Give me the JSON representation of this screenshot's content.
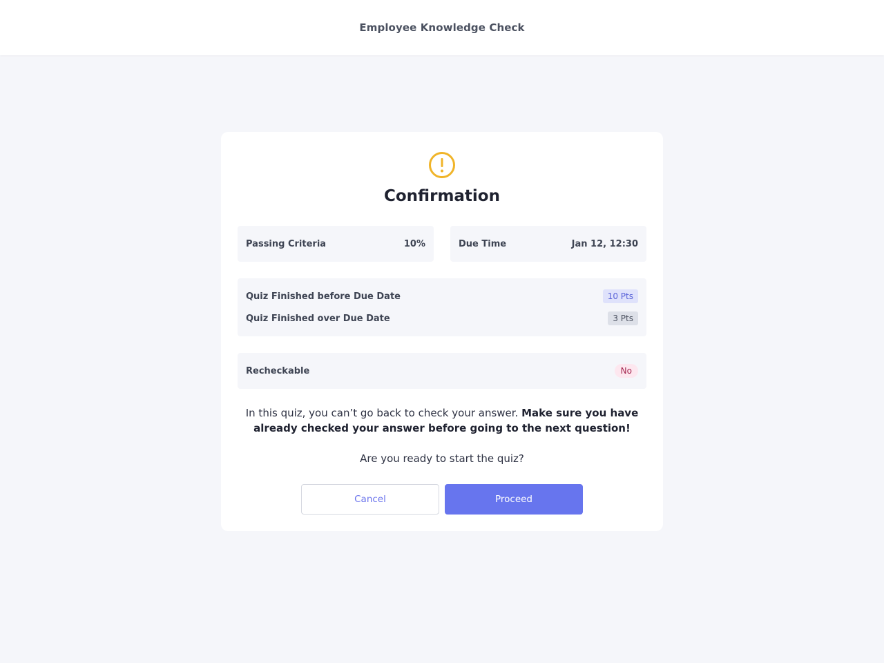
{
  "header": {
    "title": "Employee Knowledge Check"
  },
  "dialog": {
    "icon": "exclamation-circle-icon",
    "title": "Confirmation",
    "passing_criteria": {
      "label": "Passing Criteria",
      "value": "10%"
    },
    "due_time": {
      "label": "Due Time",
      "value": "Jan 12, 12:30"
    },
    "points": [
      {
        "label": "Quiz Finished before Due Date",
        "value": "10 Pts"
      },
      {
        "label": "Quiz Finished over Due Date",
        "value": "3 Pts"
      }
    ],
    "recheckable": {
      "label": "Recheckable",
      "value": "No"
    },
    "description_normal": "In this quiz, you can’t go back to check your answer.",
    "description_bold": "Make sure you have already checked your answer before going to the next question!",
    "question": "Are you ready to start the quiz?",
    "cancel_label": "Cancel",
    "proceed_label": "Proceed"
  },
  "colors": {
    "background": "#f5f6fa",
    "accent": "#6775ee",
    "warning": "#f0b429",
    "badge_no_bg": "#fde7ef",
    "badge_no_text": "#a3244d"
  }
}
